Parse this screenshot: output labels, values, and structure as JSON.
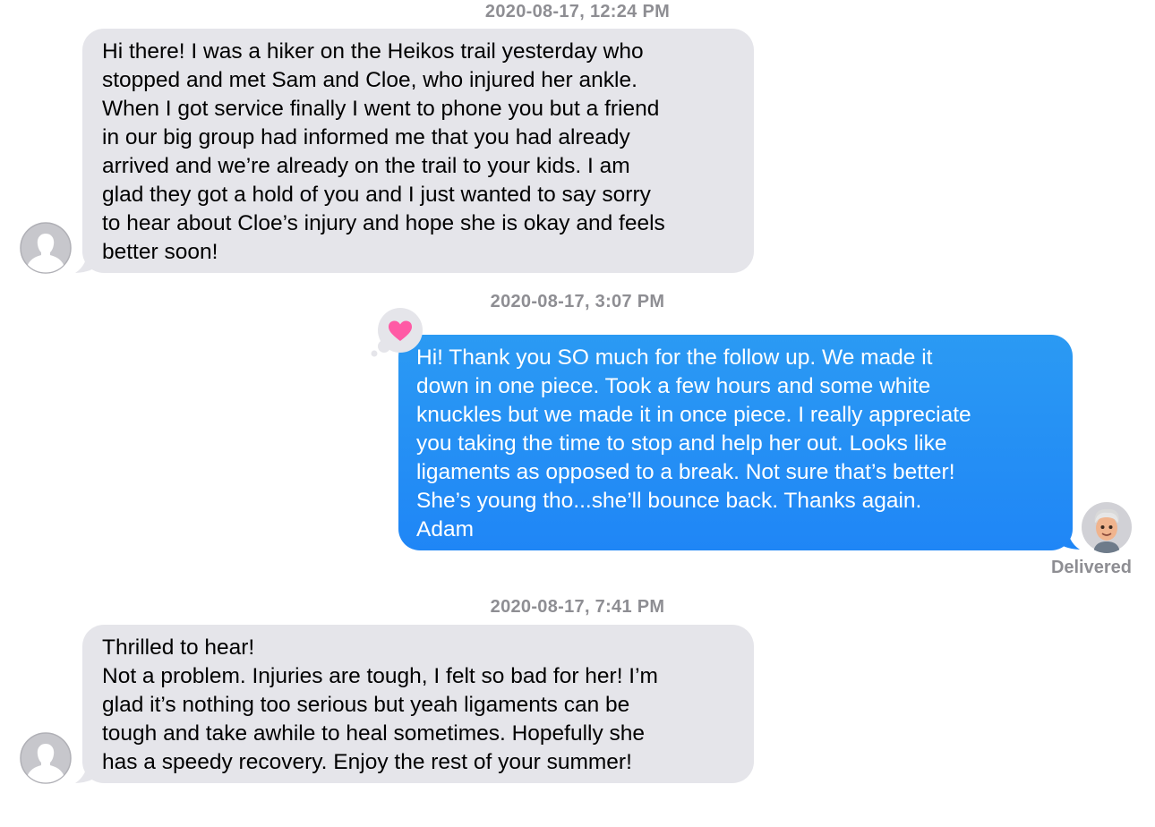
{
  "messages": [
    {
      "timestamp": "2020-08-17, 12:24 PM",
      "text": "Hi there! I was a hiker on the Heikos trail yesterday who\nstopped and met Sam and Cloe, who injured her ankle.\nWhen I got service finally I went to phone you but a friend\nin our big group had informed me that you had already\narrived and we’re already on the trail to your kids. I am\nglad they got a hold of you and I just wanted to say sorry\nto hear about Cloe’s injury and hope she is okay and feels\nbetter soon!"
    },
    {
      "timestamp": "2020-08-17, 3:07 PM",
      "text": "Hi!  Thank you SO much for the follow up.   We made it\ndown in one piece.  Took a few hours and some white\nknuckles but we made it in once piece.  I really appreciate\nyou taking the time to stop and help her out.  Looks like\nligaments as opposed to a break. Not sure that’s better!\nShe’s young tho...she’ll bounce back.  Thanks again.\n Adam",
      "status": "Delivered",
      "reaction": "heart-icon"
    },
    {
      "timestamp": "2020-08-17, 7:41 PM",
      "text": "Thrilled to hear!\nNot a problem. Injuries are tough, I felt so bad for her! I’m\nglad it’s nothing too serious but yeah ligaments can be\ntough and take awhile to heal sometimes. Hopefully she\nhas a speedy recovery. Enjoy the rest of your summer!"
    }
  ],
  "colors": {
    "incoming_bubble": "#e5e5ea",
    "outgoing_bubble": "#1f86f6",
    "timestamp_text": "#8e8e93",
    "heart": "#ff5aa5"
  }
}
